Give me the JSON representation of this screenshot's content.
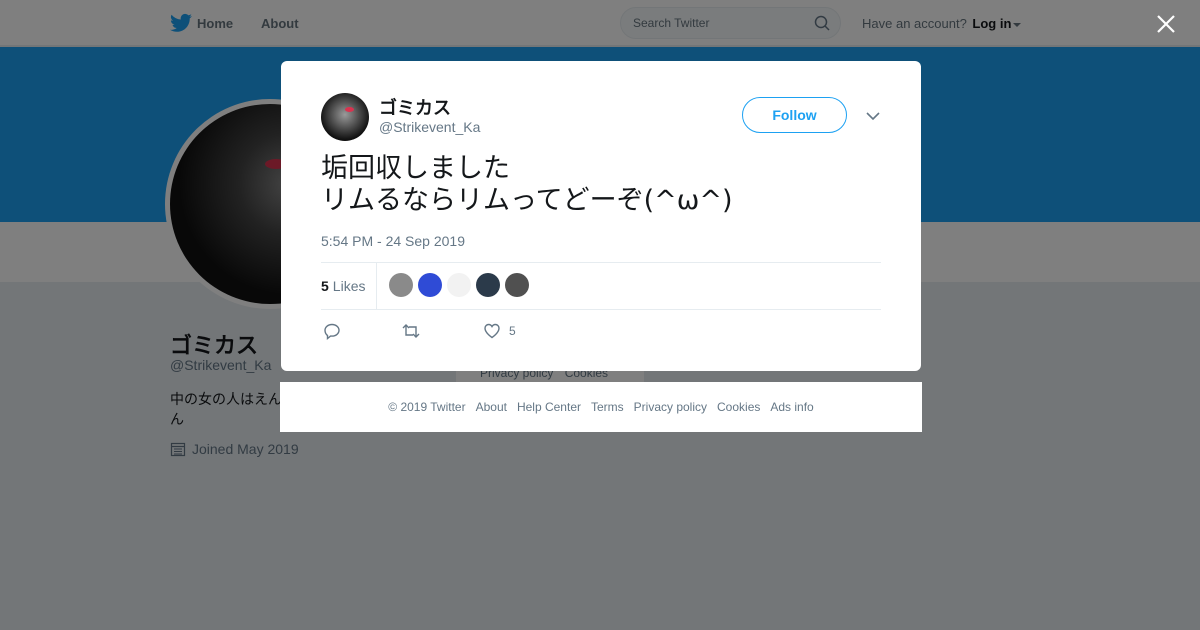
{
  "topbar": {
    "home_label": "Home",
    "about_label": "About",
    "search_placeholder": "Search Twitter",
    "account_prompt": "Have an account?",
    "login_label": "Log in"
  },
  "profile": {
    "name": "ゴミカス",
    "handle": "@Strikevent_Ka",
    "bio": "中の女の人はえんん",
    "joined": "Joined May 2019",
    "footer_links": [
      "Privacy policy",
      "Cookies"
    ]
  },
  "tweet": {
    "author_name": "ゴミカス",
    "author_handle": "@Strikevent_Ka",
    "follow_label": "Follow",
    "text_lines": [
      "垢回収しました",
      "リムるならリムってどーぞ(^ω^)"
    ],
    "timestamp": "5:54 PM - 24 Sep 2019",
    "likes_count": "5",
    "likes_label": "Likes",
    "liker_colors": [
      "#8a8a8a",
      "#2f4bd6",
      "#f2f2f2",
      "#2b3a4a",
      "#505050"
    ],
    "like_action_count": "5"
  },
  "footer": {
    "copyright": "© 2019 Twitter",
    "links": [
      "About",
      "Help Center",
      "Terms",
      "Privacy policy",
      "Cookies",
      "Ads info"
    ]
  },
  "colors": {
    "accent": "#1da1f2",
    "banner": "#1da1f2",
    "text_secondary": "#657786"
  },
  "icons": [
    "twitter-bird-icon",
    "home-icon",
    "search-icon",
    "caret-down-icon",
    "close-icon",
    "chevron-down-icon",
    "reply-icon",
    "retweet-icon",
    "heart-icon",
    "calendar-icon"
  ]
}
